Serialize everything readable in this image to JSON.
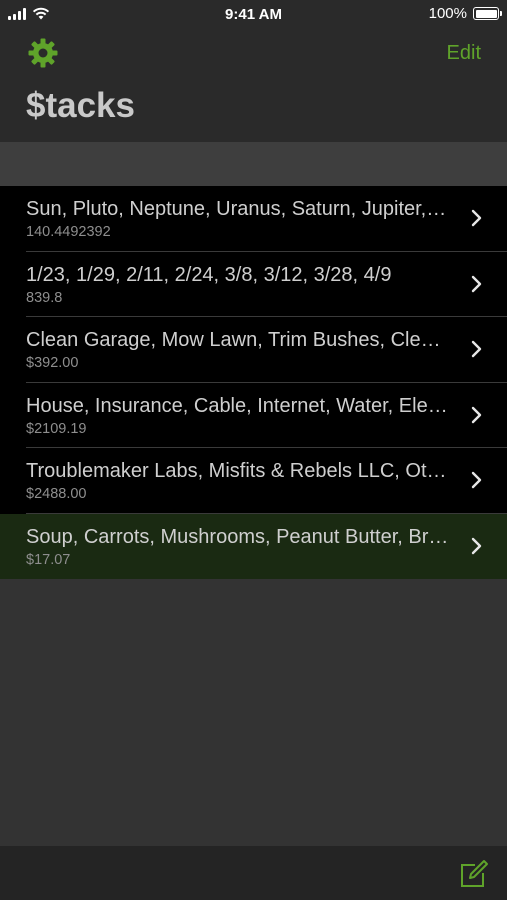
{
  "status_bar": {
    "time": "9:41 AM",
    "battery_pct": "100%",
    "icons": [
      "signal-icon",
      "wifi-icon",
      "battery-icon"
    ]
  },
  "header": {
    "settings_icon": "gear-icon",
    "edit_label": "Edit",
    "title": "$tacks",
    "accent_color": "#5fa32a"
  },
  "stacks": [
    {
      "title": "Sun, Pluto, Neptune, Uranus, Saturn, Jupiter, Mars, Earth, Venus, Mercury",
      "subtitle": "140.4492392",
      "selected": false
    },
    {
      "title": "1/23, 1/29, 2/11, 2/24, 3/8, 3/12, 3/28, 4/9",
      "subtitle": "839.8",
      "selected": false
    },
    {
      "title": "Clean Garage, Mow Lawn, Trim Bushes, Clean Gutters",
      "subtitle": "$392.00",
      "selected": false
    },
    {
      "title": "House, Insurance, Cable, Internet, Water, Electric",
      "subtitle": "$2109.19",
      "selected": false
    },
    {
      "title": "Troublemaker Labs, Misfits & Rebels LLC, Other",
      "subtitle": "$2488.00",
      "selected": false
    },
    {
      "title": "Soup, Carrots, Mushrooms, Peanut Butter, Bread",
      "subtitle": "$17.07",
      "selected": true
    }
  ],
  "toolbar": {
    "compose_icon": "compose-icon"
  }
}
